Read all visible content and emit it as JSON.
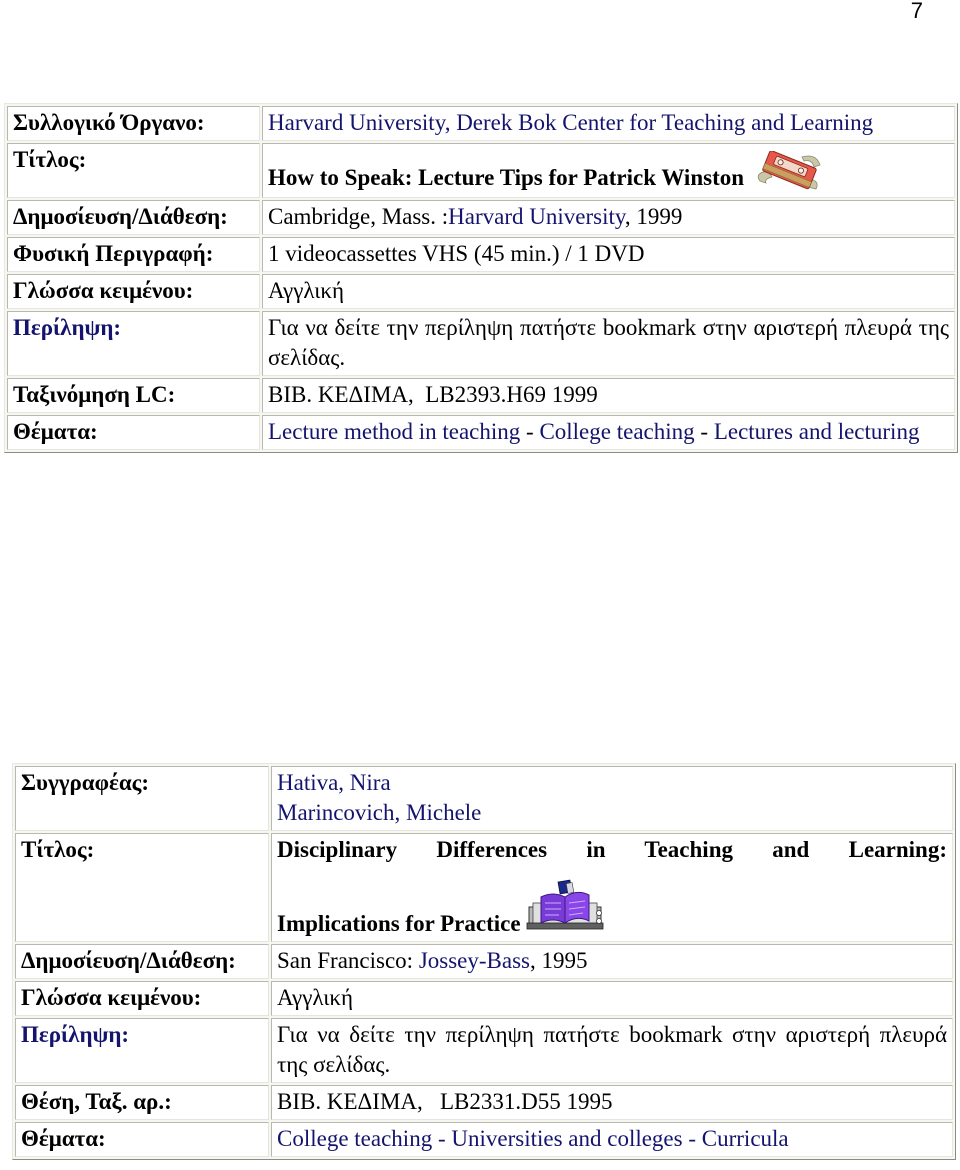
{
  "page": {
    "number": "7"
  },
  "record1": {
    "corporate_body": {
      "label": "Συλλογικό Όργανο:",
      "value": "Harvard University, Derek Bok Center for Teaching and Learning"
    },
    "title": {
      "label": "Τίτλος:",
      "value": "How to Speak: Lecture Tips for Patrick Winston",
      "icon": "videocassette-icon"
    },
    "publication": {
      "label": "Δημοσίευση/Διάθεση:",
      "place": "Cambridge, Mass. :",
      "publisher": "Harvard University",
      "year": ", 1999"
    },
    "physical_description": {
      "label": "Φυσική Περιγραφή:",
      "value": "1 videocassettes VHS (45 min.) / 1 DVD"
    },
    "language": {
      "label": "Γλώσσα κειμένου:",
      "value": "Αγγλική"
    },
    "summary": {
      "label": "Περίληψη:",
      "value": "Για να δείτε την περίληψη πατήστε bookmark στην αριστερή πλευρά της σελίδας."
    },
    "lc_classification": {
      "label": "Ταξινόμηση LC:",
      "value": "BIB. ΚΕΔΙΜΑ,  LB2393.H69 1999"
    },
    "subjects": {
      "label": "Θέματα:",
      "items": [
        "Lecture method in teaching",
        "College teaching",
        "Lectures and lecturing"
      ],
      "separator": " - "
    }
  },
  "record2": {
    "authors": {
      "label": "Συγγραφέας:",
      "items": [
        "Hativa, Nira",
        "Marincovich, Michele"
      ]
    },
    "title": {
      "label": "Τίτλος:",
      "line1": "Disciplinary Differences in Teaching and Learning:",
      "line2": "Implications for Practice",
      "icon": "book-icon"
    },
    "publication": {
      "label": "Δημοσίευση/Διάθεση:",
      "place": "San Francisco: ",
      "publisher": "Jossey-Bass",
      "year": ", 1995"
    },
    "language": {
      "label": "Γλώσσα κειμένου:",
      "value": "Αγγλική"
    },
    "summary": {
      "label": "Περίληψη:",
      "value": "Για να δείτε την περίληψη πατήστε bookmark στην αριστερή πλευρά της σελίδας."
    },
    "call_number": {
      "label": "Θέση, Ταξ. αρ.:",
      "value": "BIB. ΚΕΔΙΜΑ,   LB2331.D55 1995"
    },
    "subjects": {
      "label": "Θέματα:",
      "items": [
        "College teaching",
        "Universities and colleges",
        "Curricula"
      ],
      "separator": " - "
    }
  },
  "colors": {
    "link": "#14146e",
    "text": "#000000",
    "cell_border": "#b8b8b0",
    "table_bg": "#f7f7f2"
  }
}
